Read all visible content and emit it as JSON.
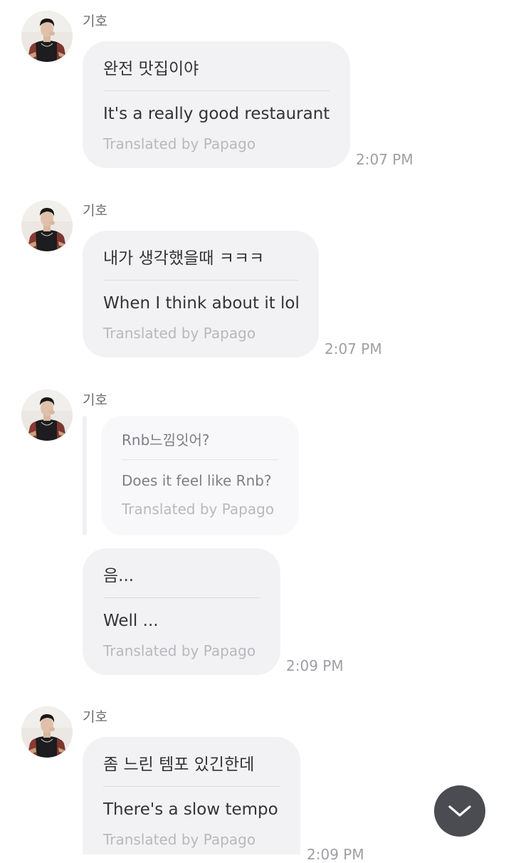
{
  "chat": {
    "sender": "기호",
    "messages": [
      {
        "original": "완전 맛집이야",
        "translation": "It's a really good restaurant",
        "translated_by": "Translated by Papago",
        "time": "2:07 PM"
      },
      {
        "original": "내가 생각했을때 ㅋㅋㅋ",
        "translation": "When I think about it lol",
        "translated_by": "Translated by Papago",
        "time": "2:07 PM"
      },
      {
        "quote": {
          "original": "Rnb느낌잇어?",
          "translation": "Does it feel like Rnb?",
          "translated_by": "Translated by Papago"
        },
        "original": "음...",
        "translation": "Well ...",
        "translated_by": "Translated by Papago",
        "time": "2:09 PM"
      },
      {
        "original": "좀 느린 템포 있긴한데",
        "translation": "There's a slow tempo",
        "translated_by": "Translated by Papago",
        "time": "2:09 PM"
      }
    ]
  },
  "scroll_button": {
    "icon": "chevron-down-icon",
    "color": "#4b4b52"
  }
}
